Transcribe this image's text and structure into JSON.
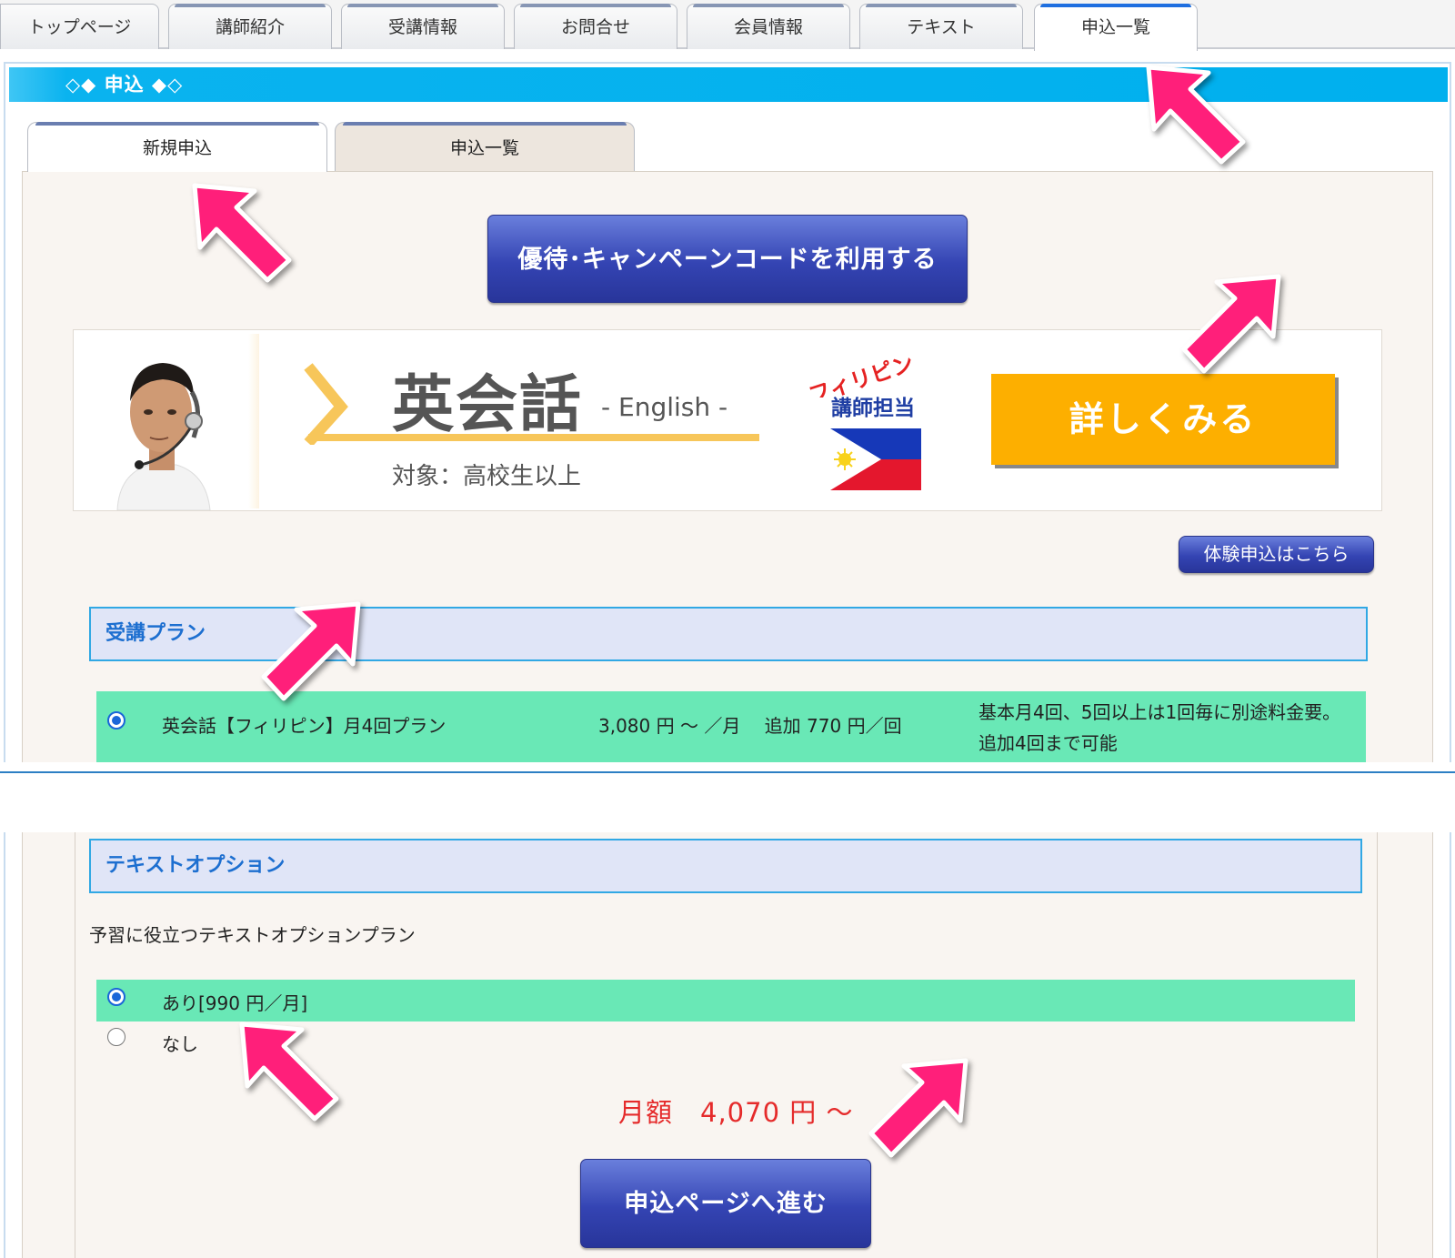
{
  "nav": {
    "tabs": [
      {
        "label": "トップページ"
      },
      {
        "label": "講師紹介"
      },
      {
        "label": "受講情報"
      },
      {
        "label": "お問合せ"
      },
      {
        "label": "会員情報"
      },
      {
        "label": "テキスト"
      },
      {
        "label": "申込一覧"
      }
    ],
    "active_index": 6
  },
  "header": {
    "title": "◇◆ 申込 ◆◇"
  },
  "subtabs": [
    {
      "label": "新規申込",
      "active": true
    },
    {
      "label": "申込一覧",
      "active": false
    }
  ],
  "campaign_button": "優待･キャンペーンコードを利用する",
  "banner": {
    "title": "英会話",
    "subtitle": "- English -",
    "target": "対象：高校生以上",
    "philippine_label": "フィリピン",
    "teacher_label": "講師担当",
    "detail_button": "詳しくみる"
  },
  "trial_button": "体験申込はこちら",
  "plan_section": {
    "heading": "受講プラン",
    "plans": [
      {
        "label": "英会話【フィリピン】月4回プラン",
        "price": "3,080 円 ～ ／月　 追加 770 円／回",
        "note_line1": "基本月4回、5回以上は1回毎に別途料金要。",
        "note_line2": "追加4回まで可能",
        "selected": true
      }
    ]
  },
  "text_option": {
    "heading": "テキストオプション",
    "description": "予習に役立つテキストオプションプラン",
    "options": [
      {
        "label": "あり[990 円／月]",
        "selected": true
      },
      {
        "label": "なし",
        "selected": false
      }
    ]
  },
  "monthly_total": "月額　4,070 円 ～",
  "proceed_button": "申込ページへ進む",
  "colors": {
    "header_band": "#00b0ee",
    "selected_row": "#69e8b6",
    "primary_button": "#3444b3",
    "detail_button": "#fdaf00",
    "price_text": "#e52b2b",
    "arrow": "#ff1f7a"
  }
}
